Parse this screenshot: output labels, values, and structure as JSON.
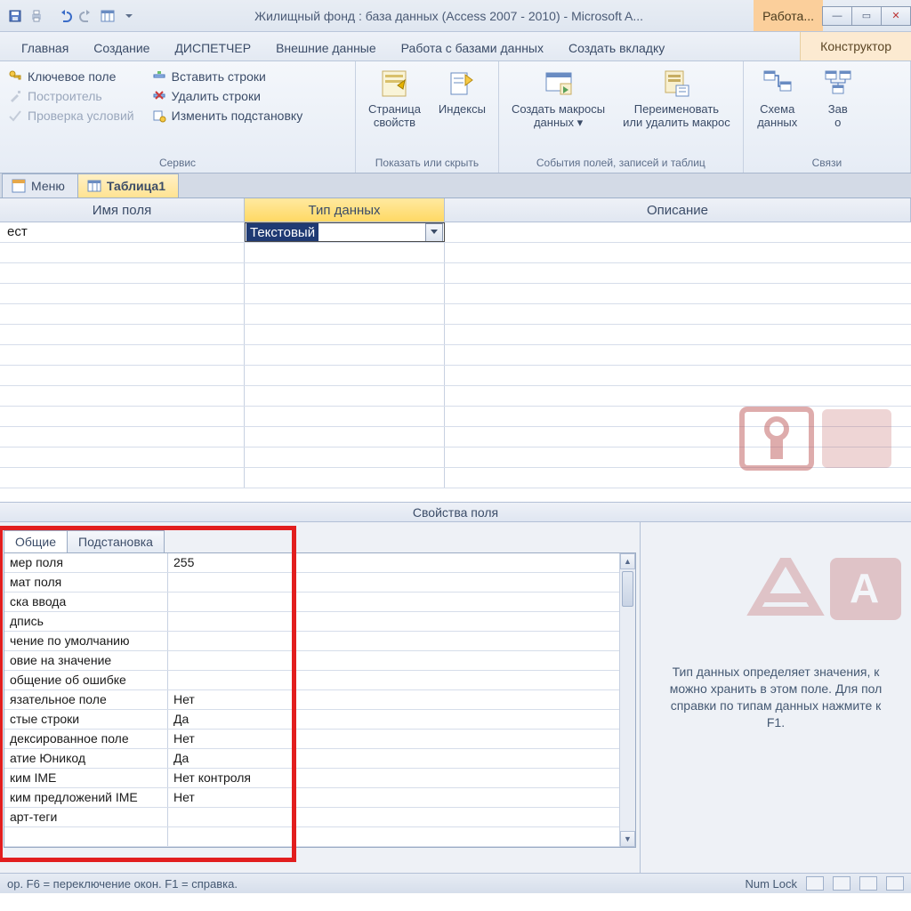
{
  "window": {
    "title": "Жилищный фонд : база данных (Access 2007 - 2010)  -  Microsoft A...",
    "context_tab": "Работа...",
    "constructor_tab": "Конструктор"
  },
  "ribbon_tabs": [
    "Главная",
    "Создание",
    "ДИСПЕТЧЕР",
    "Внешние данные",
    "Работа с базами данных",
    "Создать вкладку"
  ],
  "ribbon": {
    "group_service": {
      "title": "Сервис",
      "key_field": "Ключевое поле",
      "builder": "Построитель",
      "validate": "Проверка условий",
      "insert_rows": "Вставить строки",
      "delete_rows": "Удалить строки",
      "modify_lookup": "Изменить подстановку"
    },
    "group_show": {
      "title": "Показать или скрыть",
      "prop_sheet_line1": "Страница",
      "prop_sheet_line2": "свойств",
      "indexes": "Индексы"
    },
    "group_events": {
      "title": "События полей, записей и таблиц",
      "create_macros_line1": "Создать макросы",
      "create_macros_line2": "данных ▾",
      "rename_line1": "Переименовать",
      "rename_line2": "или удалить макрос"
    },
    "group_rel": {
      "title": "Связи",
      "schema_line1": "Схема",
      "schema_line2": "данных",
      "deps_line1": "Зав",
      "deps_line2": "о"
    }
  },
  "doc_tabs": {
    "menu": "Меню",
    "table1": "Таблица1"
  },
  "design_grid": {
    "headers": {
      "name": "Имя поля",
      "type": "Тип данных",
      "desc": "Описание"
    },
    "row1": {
      "name": "ест",
      "type": "Текстовый"
    }
  },
  "props": {
    "title": "Свойства поля",
    "tab_general": "Общие",
    "tab_lookup": "Подстановка",
    "rows": [
      {
        "label": "мер поля",
        "value": "255"
      },
      {
        "label": "мат поля",
        "value": ""
      },
      {
        "label": "ска ввода",
        "value": ""
      },
      {
        "label": "дпись",
        "value": ""
      },
      {
        "label": "чение по умолчанию",
        "value": ""
      },
      {
        "label": "овие на значение",
        "value": ""
      },
      {
        "label": "общение об ошибке",
        "value": ""
      },
      {
        "label": "язательное поле",
        "value": "Нет"
      },
      {
        "label": "стые строки",
        "value": "Да"
      },
      {
        "label": "дексированное поле",
        "value": "Нет"
      },
      {
        "label": "атие Юникод",
        "value": "Да"
      },
      {
        "label": "ким IME",
        "value": "Нет контроля"
      },
      {
        "label": "ким предложений IME",
        "value": "Нет"
      },
      {
        "label": "арт-теги",
        "value": ""
      }
    ],
    "help_text": "Тип данных определяет значения, к\nможно хранить в этом поле. Для пол\nсправки по типам данных нажмите к\nF1."
  },
  "statusbar": {
    "left": "ор.  F6 = переключение окон.  F1 = справка.",
    "numlock": "Num Lock"
  }
}
